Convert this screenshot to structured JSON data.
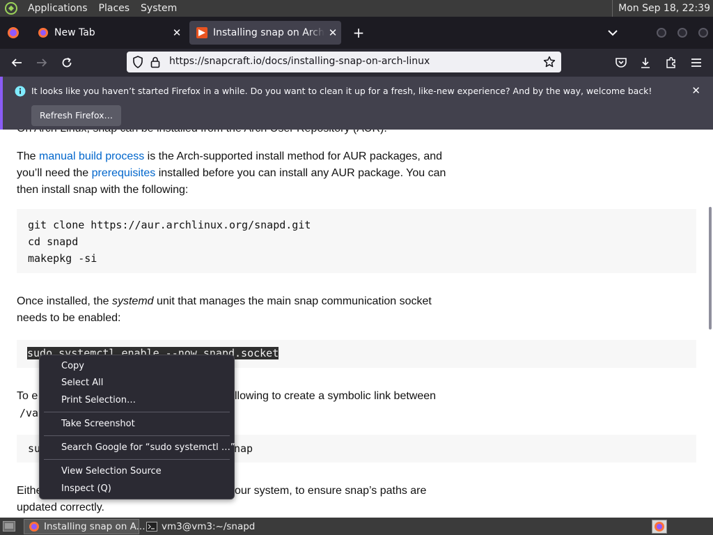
{
  "top_panel": {
    "menus": [
      "Applications",
      "Places",
      "System"
    ],
    "clock": "Mon Sep 18, 22:39"
  },
  "tabs": [
    {
      "title": "New Tab",
      "active": false
    },
    {
      "title": "Installing snap on Arch Linux",
      "active": true
    }
  ],
  "nav": {
    "url": "https://snapcraft.io/docs/installing-snap-on-arch-linux"
  },
  "notification": {
    "message": "It looks like you haven’t started Firefox in a while. Do you want to clean it up for a fresh, like-new experience? And by the way, welcome back!",
    "button_label": "Refresh Firefox…"
  },
  "content": {
    "partial_top_line": "On Arch Linux, snap can be installed from the Arch User Repository (AUR).",
    "para1": {
      "t1": "The ",
      "link1": "manual build process",
      "t2": " is the Arch-supported install method for AUR packages, and you’ll need the ",
      "link2": "prerequisites",
      "t3": " installed before you can install any AUR package. You can then install snap with the following:"
    },
    "code1": [
      "git clone https://aur.archlinux.org/snapd.git",
      "cd snapd",
      "makepkg -si"
    ],
    "para2": {
      "t1": "Once installed, the ",
      "em": "systemd",
      "t2": " unit that manages the main snap communication socket needs to be enabled:"
    },
    "code2": "sudo systemctl enable --now snapd.socket",
    "para3_visible_start": "To e",
    "para3_visible_end": "llowing to create a symbolic link between",
    "para3_line2_start": "/va",
    "code3_visible_start": "su",
    "code3_visible_end": "nap",
    "para4_visible_start": "Eithe",
    "para4_visible_end": "our system, to ensure snap’s paths are",
    "para4_line2": "updated correctly."
  },
  "context_menu": {
    "items": [
      {
        "label": "Copy",
        "accesskey": "C"
      },
      {
        "label": "Select All",
        "accesskey": "A"
      },
      {
        "label": "Print Selection…",
        "accesskey": "r"
      },
      {
        "label": "Take Screenshot",
        "accesskey": "T"
      },
      {
        "label": "Search Google for “sudo systemctl …”",
        "accesskey": "S"
      },
      {
        "label": "View Selection Source",
        "accesskey": "e"
      },
      {
        "label": "Inspect (Q)",
        "accesskey": ""
      }
    ]
  },
  "taskbar": {
    "tasks": [
      {
        "label": "Installing snap on A...",
        "active": true
      },
      {
        "label": "vm3@vm3:~/snapd",
        "active": false
      }
    ]
  }
}
